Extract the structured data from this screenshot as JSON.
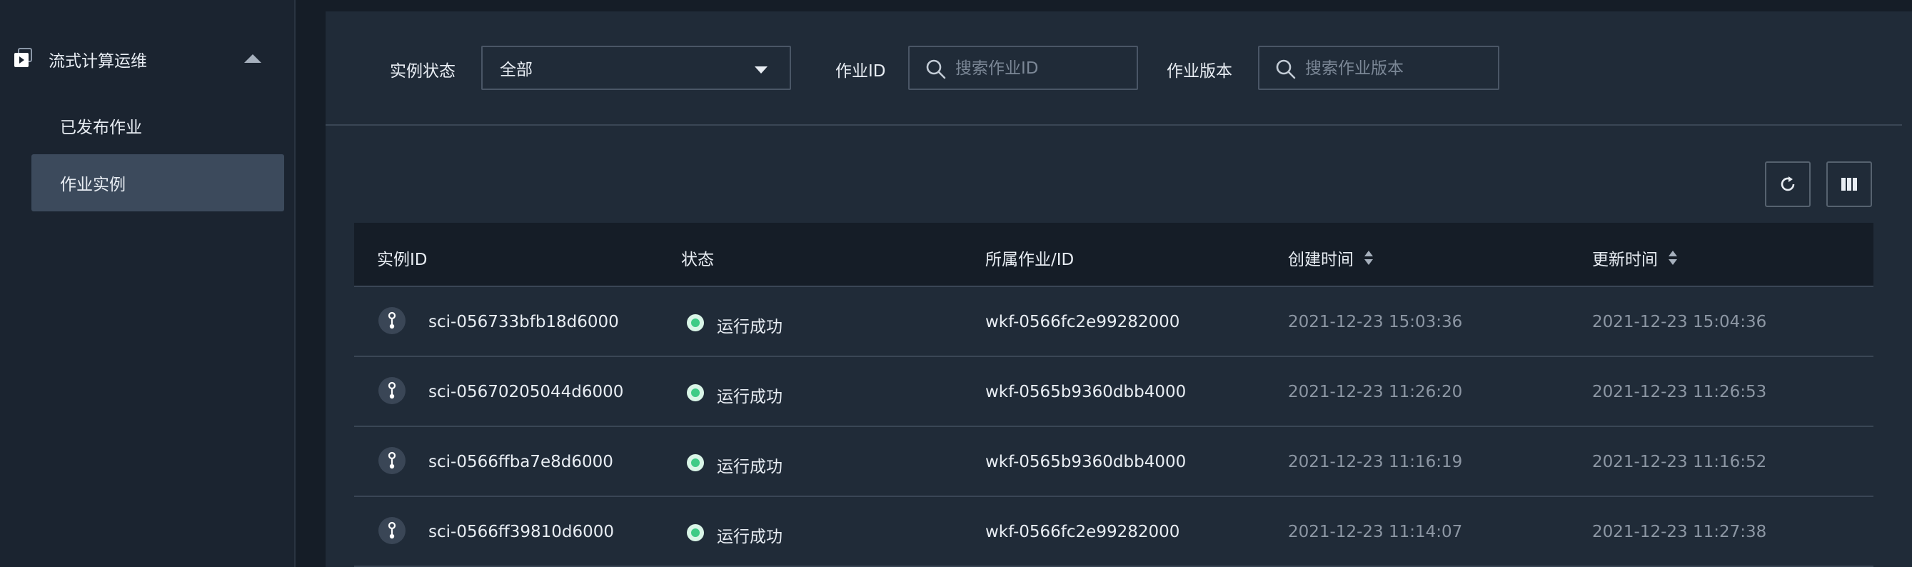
{
  "sidebar": {
    "group_label": "流式计算运维",
    "items": [
      {
        "label": "已发布作业"
      },
      {
        "label": "作业实例"
      }
    ]
  },
  "filters": {
    "status_label": "实例状态",
    "status_value": "全部",
    "job_id_label": "作业ID",
    "job_id_placeholder": "搜索作业ID",
    "job_version_label": "作业版本",
    "job_version_placeholder": "搜索作业版本"
  },
  "table": {
    "columns": [
      "实例ID",
      "状态",
      "所属作业/ID",
      "创建时间",
      "更新时间"
    ],
    "rows": [
      {
        "id": "sci-056733bfb18d6000",
        "status": "运行成功",
        "job": "wkf-0566fc2e99282000",
        "created": "2021-12-23 15:03:36",
        "updated": "2021-12-23 15:04:36"
      },
      {
        "id": "sci-05670205044d6000",
        "status": "运行成功",
        "job": "wkf-0565b9360dbb4000",
        "created": "2021-12-23 11:26:20",
        "updated": "2021-12-23 11:26:53"
      },
      {
        "id": "sci-0566ffba7e8d6000",
        "status": "运行成功",
        "job": "wkf-0565b9360dbb4000",
        "created": "2021-12-23 11:16:19",
        "updated": "2021-12-23 11:16:52"
      },
      {
        "id": "sci-0566ff39810d6000",
        "status": "运行成功",
        "job": "wkf-0566fc2e99282000",
        "created": "2021-12-23 11:14:07",
        "updated": "2021-12-23 11:27:38"
      }
    ]
  },
  "icons": {
    "group": "play-icon",
    "collapse": "caret-up-icon",
    "dropdown": "caret-down-icon",
    "search": "search-icon",
    "refresh": "refresh-icon",
    "columns": "columns-icon",
    "instance": "instance-icon",
    "status": "status-dot-icon",
    "sort": "sort-icon"
  },
  "colors": {
    "success": "#3ecb86",
    "active_item": "#3c4a5c"
  }
}
